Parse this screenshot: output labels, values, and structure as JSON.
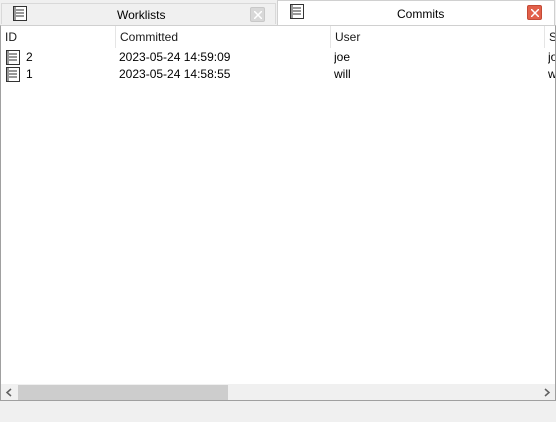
{
  "tabs": [
    {
      "label": "Worklists",
      "active": false
    },
    {
      "label": "Commits",
      "active": true
    }
  ],
  "columns": [
    "ID",
    "Committed",
    "User",
    "S"
  ],
  "rows": [
    {
      "id": "2",
      "committed": "2023-05-24 14:59:09",
      "user": "joe",
      "s": "jo"
    },
    {
      "id": "1",
      "committed": "2023-05-24 14:58:55",
      "user": "will",
      "s": "w"
    }
  ],
  "colors": {
    "active_close": "#e2604a",
    "scroll_thumb": "#cdcdcd"
  }
}
